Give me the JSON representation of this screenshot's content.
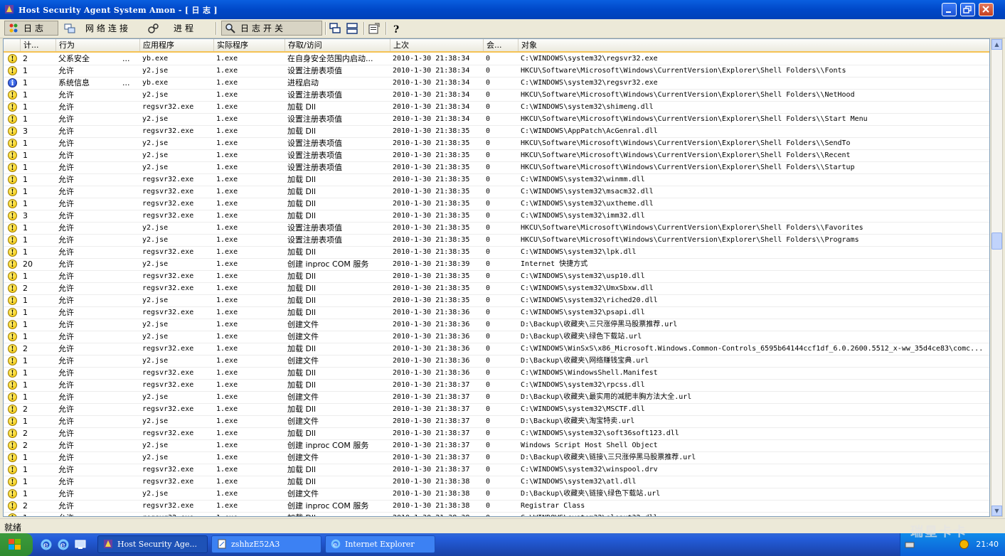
{
  "window": {
    "title": "Host Security Agent System Amon - [ 日 志 ]"
  },
  "toolbar": {
    "tabs": [
      {
        "label": "日志",
        "icon": "colored-dots-icon"
      },
      {
        "label": "网络连接",
        "icon": "network-icon"
      },
      {
        "label": "进程",
        "icon": "process-icon"
      },
      {
        "label": "日志开关",
        "icon": "magnifier-icon"
      }
    ],
    "icons": [
      "tile-horizontal-icon",
      "tile-vertical-icon",
      "properties-icon",
      "help-icon"
    ]
  },
  "table": {
    "columns": [
      "计...",
      "行为",
      "应用程序",
      "实际程序",
      "存取/访问",
      "上次",
      "会...",
      "对象"
    ],
    "rows": [
      {
        "sev": "warn",
        "count": "2",
        "action": "父系安全",
        "dots": "...",
        "app": "yb.exe",
        "real": "1.exe",
        "access": "在自身安全范围内启动...",
        "time": "2010-1-30 21:38:34",
        "s": "0",
        "obj": "C:\\WINDOWS\\system32\\regsvr32.exe"
      },
      {
        "sev": "warn",
        "count": "1",
        "action": "允许",
        "dots": "",
        "app": "y2.jse",
        "real": "1.exe",
        "access": "设置注册表项值",
        "time": "2010-1-30 21:38:34",
        "s": "0",
        "obj": "HKCU\\Software\\Microsoft\\Windows\\CurrentVersion\\Explorer\\Shell Folders\\\\Fonts"
      },
      {
        "sev": "info",
        "count": "1",
        "action": "系统信息",
        "dots": "...",
        "app": "yb.exe",
        "real": "1.exe",
        "access": "进程启动",
        "time": "2010-1-30 21:38:34",
        "s": "0",
        "obj": "C:\\WINDOWS\\system32\\regsvr32.exe"
      },
      {
        "sev": "warn",
        "count": "1",
        "action": "允许",
        "dots": "",
        "app": "y2.jse",
        "real": "1.exe",
        "access": "设置注册表项值",
        "time": "2010-1-30 21:38:34",
        "s": "0",
        "obj": "HKCU\\Software\\Microsoft\\Windows\\CurrentVersion\\Explorer\\Shell Folders\\\\NetHood"
      },
      {
        "sev": "warn",
        "count": "1",
        "action": "允许",
        "dots": "",
        "app": "regsvr32.exe",
        "real": "1.exe",
        "access": "加载 Dll",
        "time": "2010-1-30 21:38:34",
        "s": "0",
        "obj": "C:\\WINDOWS\\system32\\shimeng.dll"
      },
      {
        "sev": "warn",
        "count": "1",
        "action": "允许",
        "dots": "",
        "app": "y2.jse",
        "real": "1.exe",
        "access": "设置注册表项值",
        "time": "2010-1-30 21:38:34",
        "s": "0",
        "obj": "HKCU\\Software\\Microsoft\\Windows\\CurrentVersion\\Explorer\\Shell Folders\\\\Start Menu"
      },
      {
        "sev": "warn",
        "count": "3",
        "action": "允许",
        "dots": "",
        "app": "regsvr32.exe",
        "real": "1.exe",
        "access": "加载 Dll",
        "time": "2010-1-30 21:38:35",
        "s": "0",
        "obj": "C:\\WINDOWS\\AppPatch\\AcGenral.dll"
      },
      {
        "sev": "warn",
        "count": "1",
        "action": "允许",
        "dots": "",
        "app": "y2.jse",
        "real": "1.exe",
        "access": "设置注册表项值",
        "time": "2010-1-30 21:38:35",
        "s": "0",
        "obj": "HKCU\\Software\\Microsoft\\Windows\\CurrentVersion\\Explorer\\Shell Folders\\\\SendTo"
      },
      {
        "sev": "warn",
        "count": "1",
        "action": "允许",
        "dots": "",
        "app": "y2.jse",
        "real": "1.exe",
        "access": "设置注册表项值",
        "time": "2010-1-30 21:38:35",
        "s": "0",
        "obj": "HKCU\\Software\\Microsoft\\Windows\\CurrentVersion\\Explorer\\Shell Folders\\\\Recent"
      },
      {
        "sev": "warn",
        "count": "1",
        "action": "允许",
        "dots": "",
        "app": "y2.jse",
        "real": "1.exe",
        "access": "设置注册表项值",
        "time": "2010-1-30 21:38:35",
        "s": "0",
        "obj": "HKCU\\Software\\Microsoft\\Windows\\CurrentVersion\\Explorer\\Shell Folders\\\\Startup"
      },
      {
        "sev": "warn",
        "count": "1",
        "action": "允许",
        "dots": "",
        "app": "regsvr32.exe",
        "real": "1.exe",
        "access": "加载 Dll",
        "time": "2010-1-30 21:38:35",
        "s": "0",
        "obj": "C:\\WINDOWS\\system32\\winmm.dll"
      },
      {
        "sev": "warn",
        "count": "1",
        "action": "允许",
        "dots": "",
        "app": "regsvr32.exe",
        "real": "1.exe",
        "access": "加载 Dll",
        "time": "2010-1-30 21:38:35",
        "s": "0",
        "obj": "C:\\WINDOWS\\system32\\msacm32.dll"
      },
      {
        "sev": "warn",
        "count": "1",
        "action": "允许",
        "dots": "",
        "app": "regsvr32.exe",
        "real": "1.exe",
        "access": "加载 Dll",
        "time": "2010-1-30 21:38:35",
        "s": "0",
        "obj": "C:\\WINDOWS\\system32\\uxtheme.dll"
      },
      {
        "sev": "warn",
        "count": "3",
        "action": "允许",
        "dots": "",
        "app": "regsvr32.exe",
        "real": "1.exe",
        "access": "加载 Dll",
        "time": "2010-1-30 21:38:35",
        "s": "0",
        "obj": "C:\\WINDOWS\\system32\\imm32.dll"
      },
      {
        "sev": "warn",
        "count": "1",
        "action": "允许",
        "dots": "",
        "app": "y2.jse",
        "real": "1.exe",
        "access": "设置注册表项值",
        "time": "2010-1-30 21:38:35",
        "s": "0",
        "obj": "HKCU\\Software\\Microsoft\\Windows\\CurrentVersion\\Explorer\\Shell Folders\\\\Favorites"
      },
      {
        "sev": "warn",
        "count": "1",
        "action": "允许",
        "dots": "",
        "app": "y2.jse",
        "real": "1.exe",
        "access": "设置注册表项值",
        "time": "2010-1-30 21:38:35",
        "s": "0",
        "obj": "HKCU\\Software\\Microsoft\\Windows\\CurrentVersion\\Explorer\\Shell Folders\\\\Programs"
      },
      {
        "sev": "warn",
        "count": "1",
        "action": "允许",
        "dots": "",
        "app": "regsvr32.exe",
        "real": "1.exe",
        "access": "加载 Dll",
        "time": "2010-1-30 21:38:35",
        "s": "0",
        "obj": "C:\\WINDOWS\\system32\\lpk.dll"
      },
      {
        "sev": "warn",
        "count": "20",
        "action": "允许",
        "dots": "",
        "app": "y2.jse",
        "real": "1.exe",
        "access": "创建 inproc COM 服务",
        "time": "2010-1-30 21:38:39",
        "s": "0",
        "obj": "Internet 快捷方式"
      },
      {
        "sev": "warn",
        "count": "1",
        "action": "允许",
        "dots": "",
        "app": "regsvr32.exe",
        "real": "1.exe",
        "access": "加载 Dll",
        "time": "2010-1-30 21:38:35",
        "s": "0",
        "obj": "C:\\WINDOWS\\system32\\usp10.dll"
      },
      {
        "sev": "warn",
        "count": "2",
        "action": "允许",
        "dots": "",
        "app": "regsvr32.exe",
        "real": "1.exe",
        "access": "加载 Dll",
        "time": "2010-1-30 21:38:35",
        "s": "0",
        "obj": "C:\\WINDOWS\\system32\\UmxSbxw.dll"
      },
      {
        "sev": "warn",
        "count": "1",
        "action": "允许",
        "dots": "",
        "app": "y2.jse",
        "real": "1.exe",
        "access": "加载 Dll",
        "time": "2010-1-30 21:38:35",
        "s": "0",
        "obj": "C:\\WINDOWS\\system32\\riched20.dll"
      },
      {
        "sev": "warn",
        "count": "1",
        "action": "允许",
        "dots": "",
        "app": "regsvr32.exe",
        "real": "1.exe",
        "access": "加载 Dll",
        "time": "2010-1-30 21:38:36",
        "s": "0",
        "obj": "C:\\WINDOWS\\system32\\psapi.dll"
      },
      {
        "sev": "warn",
        "count": "1",
        "action": "允许",
        "dots": "",
        "app": "y2.jse",
        "real": "1.exe",
        "access": "创建文件",
        "time": "2010-1-30 21:38:36",
        "s": "0",
        "obj": "D:\\Backup\\收藏夹\\三只涨停黑马股票推荐.url"
      },
      {
        "sev": "warn",
        "count": "1",
        "action": "允许",
        "dots": "",
        "app": "y2.jse",
        "real": "1.exe",
        "access": "创建文件",
        "time": "2010-1-30 21:38:36",
        "s": "0",
        "obj": "D:\\Backup\\收藏夹\\绿色下载站.url"
      },
      {
        "sev": "warn",
        "count": "2",
        "action": "允许",
        "dots": "",
        "app": "regsvr32.exe",
        "real": "1.exe",
        "access": "加载 Dll",
        "time": "2010-1-30 21:38:36",
        "s": "0",
        "obj": "C:\\WINDOWS\\WinSxS\\x86_Microsoft.Windows.Common-Controls_6595b64144ccf1df_6.0.2600.5512_x-ww_35d4ce83\\comc..."
      },
      {
        "sev": "warn",
        "count": "1",
        "action": "允许",
        "dots": "",
        "app": "y2.jse",
        "real": "1.exe",
        "access": "创建文件",
        "time": "2010-1-30 21:38:36",
        "s": "0",
        "obj": "D:\\Backup\\收藏夹\\网络赚钱宝典.url"
      },
      {
        "sev": "warn",
        "count": "1",
        "action": "允许",
        "dots": "",
        "app": "regsvr32.exe",
        "real": "1.exe",
        "access": "加载 Dll",
        "time": "2010-1-30 21:38:36",
        "s": "0",
        "obj": "C:\\WINDOWS\\WindowsShell.Manifest"
      },
      {
        "sev": "warn",
        "count": "1",
        "action": "允许",
        "dots": "",
        "app": "regsvr32.exe",
        "real": "1.exe",
        "access": "加载 Dll",
        "time": "2010-1-30 21:38:37",
        "s": "0",
        "obj": "C:\\WINDOWS\\system32\\rpcss.dll"
      },
      {
        "sev": "warn",
        "count": "1",
        "action": "允许",
        "dots": "",
        "app": "y2.jse",
        "real": "1.exe",
        "access": "创建文件",
        "time": "2010-1-30 21:38:37",
        "s": "0",
        "obj": "D:\\Backup\\收藏夹\\最实用的减肥丰胸方法大全.url"
      },
      {
        "sev": "warn",
        "count": "2",
        "action": "允许",
        "dots": "",
        "app": "regsvr32.exe",
        "real": "1.exe",
        "access": "加载 Dll",
        "time": "2010-1-30 21:38:37",
        "s": "0",
        "obj": "C:\\WINDOWS\\system32\\MSCTF.dll"
      },
      {
        "sev": "warn",
        "count": "1",
        "action": "允许",
        "dots": "",
        "app": "y2.jse",
        "real": "1.exe",
        "access": "创建文件",
        "time": "2010-1-30 21:38:37",
        "s": "0",
        "obj": "D:\\Backup\\收藏夹\\淘宝特卖.url"
      },
      {
        "sev": "warn",
        "count": "2",
        "action": "允许",
        "dots": "",
        "app": "regsvr32.exe",
        "real": "1.exe",
        "access": "加载 Dll",
        "time": "2010-1-30 21:38:37",
        "s": "0",
        "obj": "C:\\WINDOWS\\system32\\soft36soft123.dll"
      },
      {
        "sev": "warn",
        "count": "2",
        "action": "允许",
        "dots": "",
        "app": "y2.jse",
        "real": "1.exe",
        "access": "创建 inproc COM 服务",
        "time": "2010-1-30 21:38:37",
        "s": "0",
        "obj": "Windows Script Host Shell Object"
      },
      {
        "sev": "warn",
        "count": "1",
        "action": "允许",
        "dots": "",
        "app": "y2.jse",
        "real": "1.exe",
        "access": "创建文件",
        "time": "2010-1-30 21:38:37",
        "s": "0",
        "obj": "D:\\Backup\\收藏夹\\链接\\三只涨停黑马股票推荐.url"
      },
      {
        "sev": "warn",
        "count": "1",
        "action": "允许",
        "dots": "",
        "app": "regsvr32.exe",
        "real": "1.exe",
        "access": "加载 Dll",
        "time": "2010-1-30 21:38:37",
        "s": "0",
        "obj": "C:\\WINDOWS\\system32\\winspool.drv"
      },
      {
        "sev": "warn",
        "count": "1",
        "action": "允许",
        "dots": "",
        "app": "regsvr32.exe",
        "real": "1.exe",
        "access": "加载 Dll",
        "time": "2010-1-30 21:38:38",
        "s": "0",
        "obj": "C:\\WINDOWS\\system32\\atl.dll"
      },
      {
        "sev": "warn",
        "count": "1",
        "action": "允许",
        "dots": "",
        "app": "y2.jse",
        "real": "1.exe",
        "access": "创建文件",
        "time": "2010-1-30 21:38:38",
        "s": "0",
        "obj": "D:\\Backup\\收藏夹\\链接\\绿色下载站.url"
      },
      {
        "sev": "warn",
        "count": "2",
        "action": "允许",
        "dots": "",
        "app": "regsvr32.exe",
        "real": "1.exe",
        "access": "创建 inproc COM 服务",
        "time": "2010-1-30 21:38:38",
        "s": "0",
        "obj": "Registrar Class"
      },
      {
        "sev": "warn",
        "count": "1",
        "action": "允许",
        "dots": "",
        "app": "regsvr32.exe",
        "real": "1.exe",
        "access": "加载 Dll",
        "time": "2010-1-30 21:38:38",
        "s": "0",
        "obj": "C:\\WINDOWS\\system32\\oleaut32.dll"
      }
    ]
  },
  "status": {
    "text": "就绪"
  },
  "taskbar": {
    "tasks": [
      {
        "label": "Host Security Age...",
        "active": true
      },
      {
        "label": "zshhzE52A3",
        "active": false
      },
      {
        "label": "Internet Explorer",
        "active": false
      }
    ],
    "clock": "21:40",
    "watermark": "瑞星卡卡"
  },
  "colors": {
    "title_bar": "#0A5FE0",
    "taskbar": "#245EDC",
    "start": "#3C9A3C",
    "selection_line": "#F5C354"
  }
}
